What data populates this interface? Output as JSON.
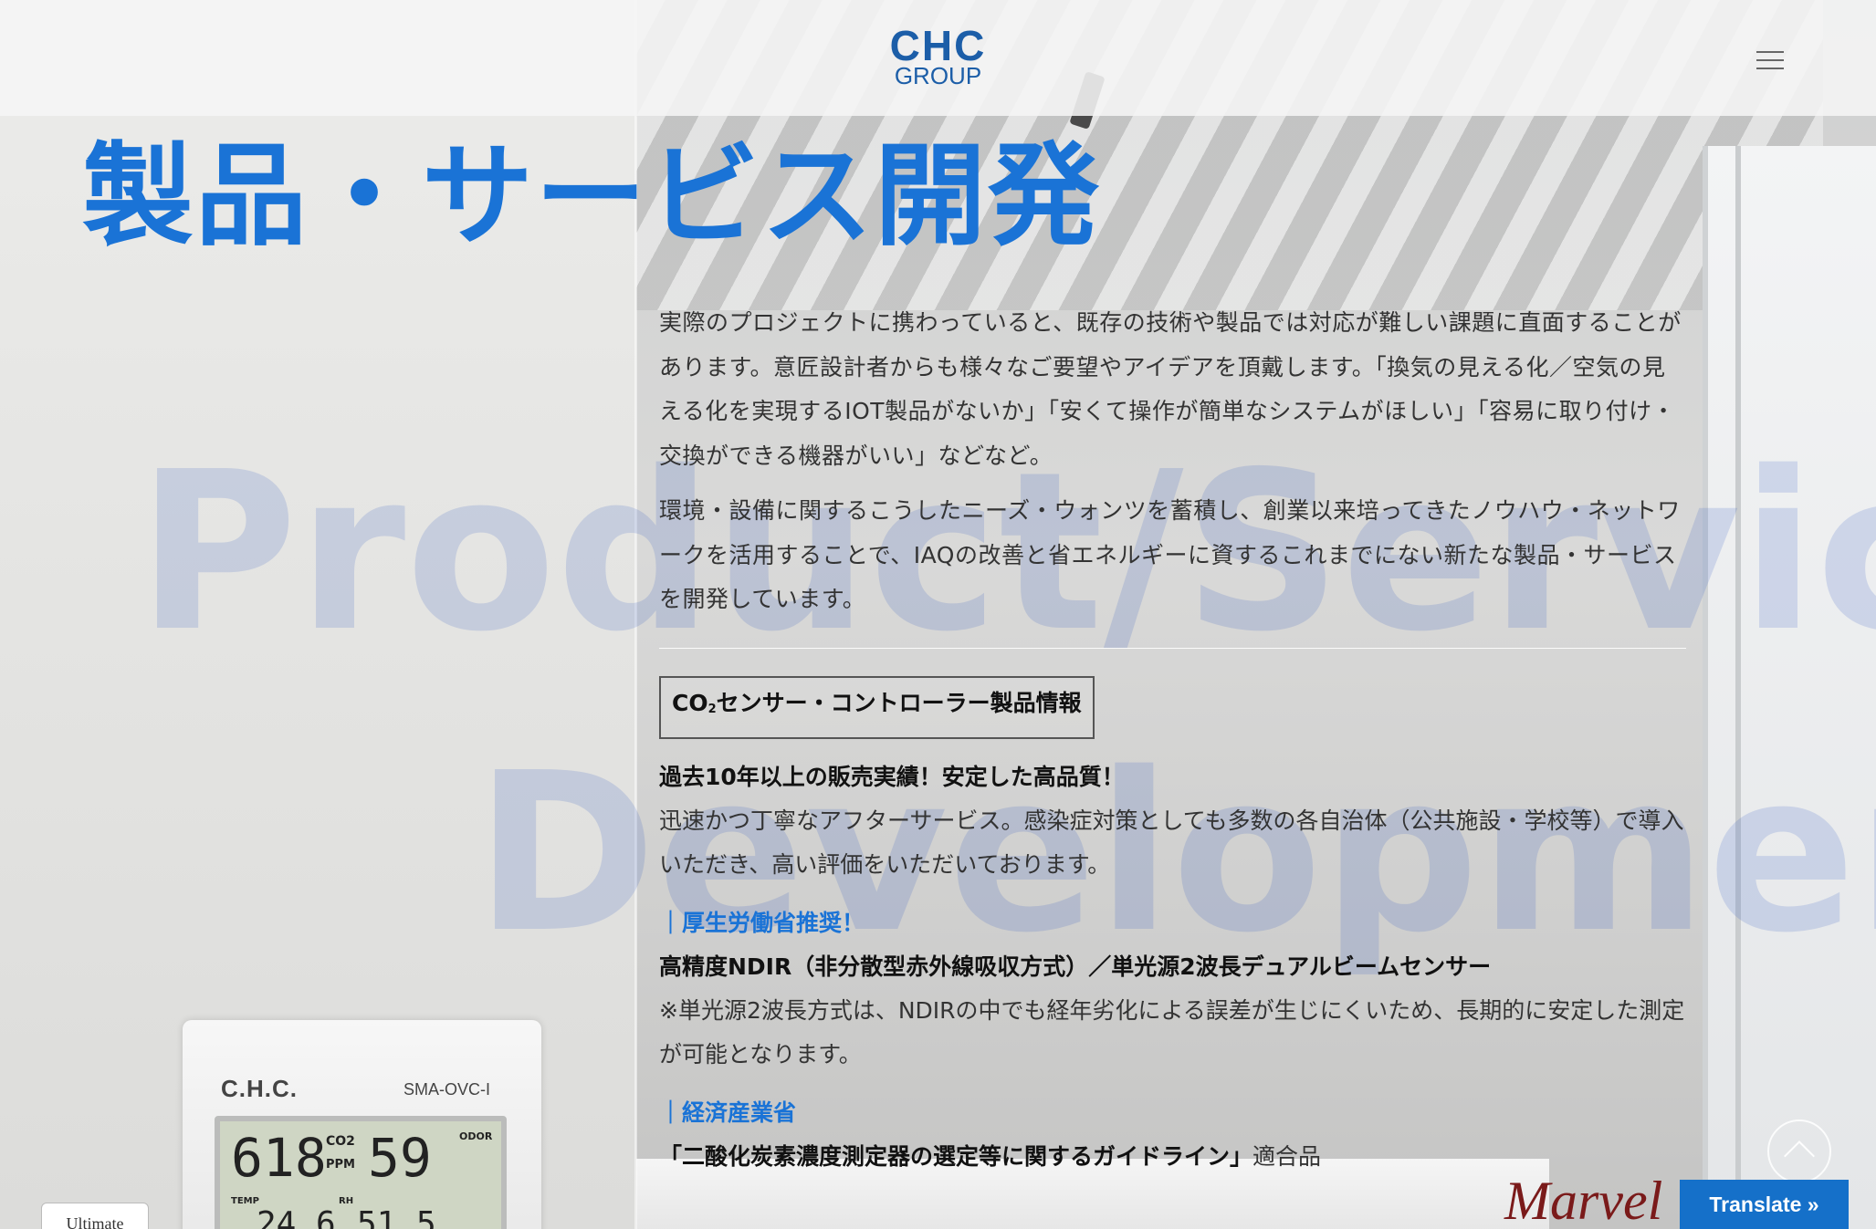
{
  "header": {
    "logo_top": "CHC",
    "logo_bottom": "GROUP"
  },
  "page": {
    "title": "製品・サービス開発",
    "watermark_line1": "Product/Service",
    "watermark_line2": "Development"
  },
  "content": {
    "paragraphs": [
      "実際のプロジェクトに携わっていると、既存の技術や製品では対応が難しい課題に直面することがあります。意匠設計者からも様々なご要望やアイデアを頂戴します。「換気の見える化／空気の見える化を実現するIOT製品がないか」「安くて操作が簡単なシステムがほしい」「容易に取り付け・交換ができる機器がいい」などなど。",
      "環境・設備に関するこうしたニーズ・ウォンツを蓄積し、創業以来培ってきたノウハウ・ネットワークを活用することで、IAQの改善と省エネルギーに資するこれまでにない新たな製品・サービスを開発しています。"
    ],
    "product_button_prefix": "CO",
    "product_button_sub": "2",
    "product_button_suffix": "センサー・コントローラー製品情報",
    "strong_1": "過去10年以上の販売実績！安定した高品質！",
    "text_1": "迅速かつ丁寧なアフターサービス。感染症対策としても多数の各自治体（公共施設・学校等）で導入いただき、高い評価をいただいております。",
    "tag_1": "厚生労働省推奨！",
    "strong_2": "高精度NDIR（非分散型赤外線吸収方式）／単光源2波長デュアルビームセンサー",
    "text_2": "※単光源2波長方式は、NDIRの中でも経年劣化による誤差が生じにくいため、長期的に安定した測定が可能となります。",
    "tag_2": "経済産業省",
    "strong_3": "「二酸化炭素濃度測定器の選定等に関するガイドライン」",
    "text_3": "適合品"
  },
  "device": {
    "brand": "C.H.C.",
    "model": "SMA-OVC-I",
    "co2_value": "618",
    "co2_label": "CO2",
    "ppm_label": "PPM",
    "odor_value": "59",
    "odor_label": "ODOR",
    "temp_label": "TEMP",
    "rh_label": "RH",
    "temp_value": "24.6",
    "rh_value": "51.5"
  },
  "badges": {
    "ultimate": "Ultimate",
    "marvel": "Marvel"
  },
  "translate": {
    "label": "Translate »"
  },
  "icons": {
    "menu": "hamburger-menu-icon",
    "scroll_top": "chevron-up-icon"
  },
  "colors": {
    "accent": "#1a73d6",
    "translate_bg": "#1570c9",
    "logo": "#1c5ea8"
  }
}
